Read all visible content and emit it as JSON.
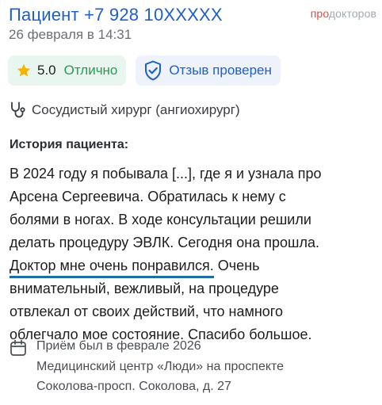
{
  "header": {
    "patient_title": "Пациент +7 928 10XXXXX",
    "date": "26 февраля в 14:31",
    "brand_pro": "про",
    "brand_doctors": "докторов"
  },
  "badges": {
    "rating_value": "5.0",
    "rating_text": "Отлично",
    "verified_text": "Отзыв проверен"
  },
  "specialty": "Сосудистый хирург (ангиохирург)",
  "section_label": "История пациента:",
  "story_lines": [
    "В 2024 году я побывала [...], где я и узнала про",
    "Арсена Сергеевича. Обратилась к нему с",
    "болями в ногах. В ходе консультации решили",
    "делать процедуру ЭВЛК. Сегодня она прошла.",
    "Доктор мне очень понравился.",
    " Очень",
    "внимательный, вежливый, на процедуре",
    "отвлекал от своих действий, что намного",
    "облегчало мое состояние. Спасибо большое."
  ],
  "visit": {
    "date_text": "Приём был в феврале 2026",
    "clinic_line1": "Медицинский центр «Люди» на проспекте",
    "clinic_line2": "Соколова-просп. Соколова, д. 27"
  },
  "colors": {
    "title_blue": "#1f5fc8",
    "rating_green": "#2a9b52",
    "star_gold": "#f5b400",
    "highlight_underline": "#1d6fa3",
    "brand_red": "#e24a4a"
  },
  "icons": [
    "star-icon",
    "shield-check-icon",
    "stethoscope-icon",
    "calendar-icon"
  ]
}
